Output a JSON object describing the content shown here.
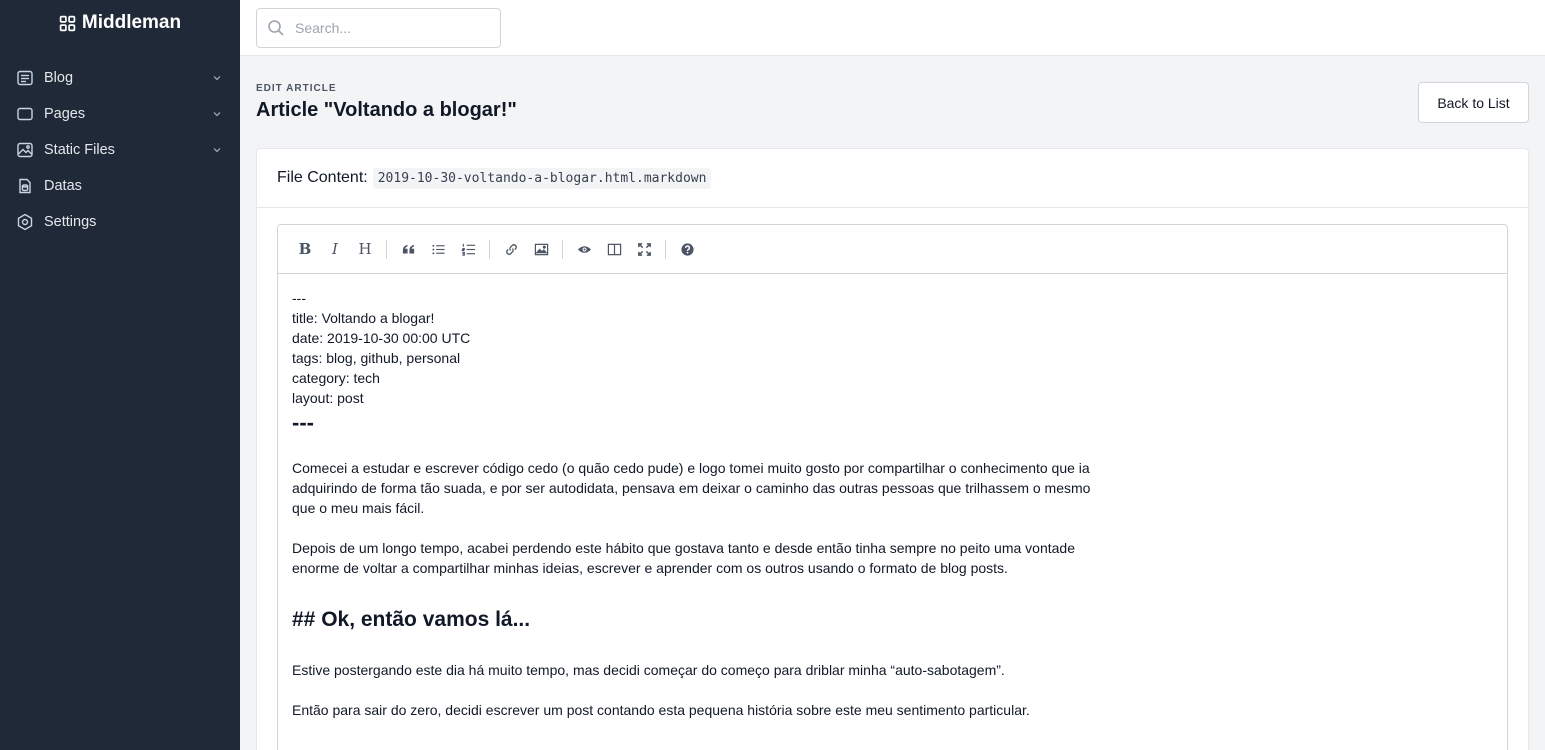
{
  "app": {
    "title": "Middleman"
  },
  "sidebar": {
    "items": [
      {
        "label": "Blog",
        "icon": "blog-icon",
        "expandable": true
      },
      {
        "label": "Pages",
        "icon": "pages-icon",
        "expandable": true
      },
      {
        "label": "Static Files",
        "icon": "image-icon",
        "expandable": true
      },
      {
        "label": "Datas",
        "icon": "database-icon",
        "expandable": false
      },
      {
        "label": "Settings",
        "icon": "settings-icon",
        "expandable": false
      }
    ]
  },
  "search": {
    "placeholder": "Search...",
    "value": ""
  },
  "header": {
    "eyebrow": "EDIT ARTICLE",
    "title": "Article \"Voltando a blogar!\"",
    "back_label": "Back to List"
  },
  "file": {
    "label": "File Content:",
    "name": "2019-10-30-voltando-a-blogar.html.markdown"
  },
  "toolbar": {
    "buttons": [
      "bold",
      "italic",
      "heading",
      "quote",
      "unordered-list",
      "ordered-list",
      "link",
      "image",
      "preview",
      "side-by-side",
      "fullscreen",
      "guide"
    ]
  },
  "editor": {
    "frontmatter": [
      "---",
      "title: Voltando a blogar!",
      "date: 2019-10-30 00:00 UTC",
      "tags: blog, github, personal",
      "category: tech",
      "layout: post"
    ],
    "rule": "---",
    "p1": "Comecei a estudar e escrever código cedo (o quão cedo pude) e logo tomei muito gosto por compartilhar o conhecimento que ia adquirindo de forma tão suada, e por ser autodidata, pensava em deixar o caminho das outras pessoas que trilhassem o mesmo que o meu mais fácil.",
    "p2": "Depois de um longo tempo, acabei perdendo este hábito que gostava tanto e desde então tinha sempre no peito uma vontade enorme de voltar a compartilhar minhas ideias, escrever e aprender com os outros usando o formato de blog posts.",
    "h2": "## Ok, então vamos lá...",
    "p3": "Estive postergando este dia há muito tempo, mas decidi começar do começo para driblar minha “auto-sabotagem”.",
    "p4": "Então para sair do zero, decidi escrever um post contando esta pequena história sobre este meu sentimento particular."
  }
}
